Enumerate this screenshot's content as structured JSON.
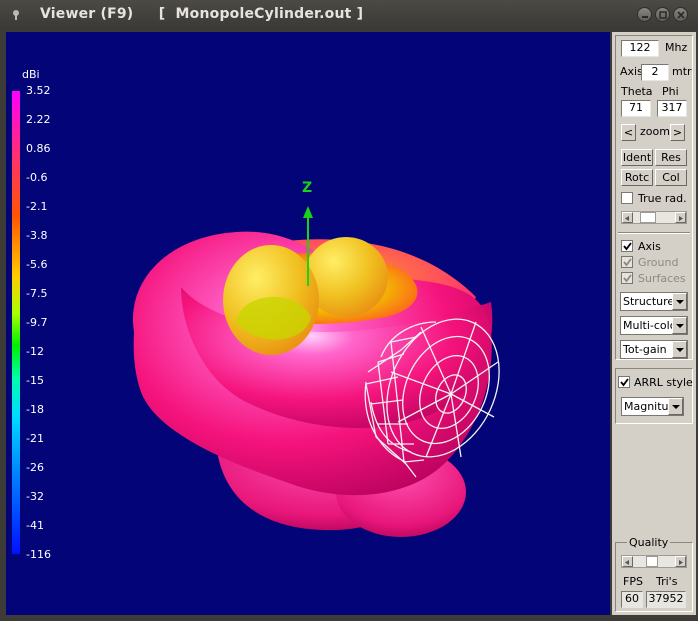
{
  "window": {
    "title": "Viewer (F9)     [  MonopoleCylinder.out ]"
  },
  "legend": {
    "unit": "dBi",
    "ticks": [
      "3.52",
      "2.22",
      "0.86",
      "-0.6",
      "-2.1",
      "-3.8",
      "-5.6",
      "-7.5",
      "-9.7",
      "-12",
      "-15",
      "-18",
      "-21",
      "-26",
      "-32",
      "-41",
      "-116"
    ]
  },
  "axis": {
    "z_label": "Z"
  },
  "panel": {
    "frequency": {
      "value": "122",
      "unit": "Mhz"
    },
    "axis_length": {
      "label": "Axis",
      "value": "2",
      "unit": "mtr"
    },
    "theta": {
      "label": "Theta",
      "value": "71"
    },
    "phi": {
      "label": "Phi",
      "value": "317"
    },
    "zoom": {
      "label": "zoom",
      "left": "<",
      "right": ">"
    },
    "buttons": {
      "ident": "Ident",
      "res": "Res",
      "rotc": "Rotc",
      "col": "Col"
    },
    "true_rad": {
      "label": "True rad.",
      "checked": false
    },
    "axis_check": {
      "label": "Axis",
      "checked": true
    },
    "ground_check": {
      "label": "Ground",
      "checked": true,
      "disabled": true
    },
    "surfaces_check": {
      "label": "Surfaces",
      "checked": true,
      "disabled": true
    },
    "combo_structure": "Structure",
    "combo_color": "Multi-colo",
    "combo_gain": "Tot-gain",
    "arrl": {
      "label": "ARRL style",
      "checked": true
    },
    "combo_magnitude": "Magnituc",
    "quality": {
      "label": "Quality"
    },
    "fps": {
      "label": "FPS",
      "value": "60"
    },
    "tris": {
      "label": "Tri's",
      "value": "37952"
    }
  }
}
